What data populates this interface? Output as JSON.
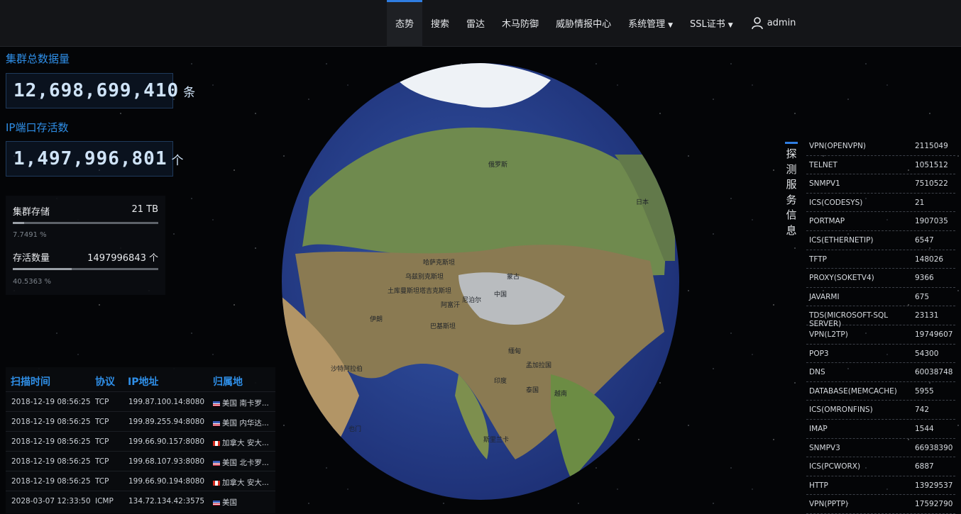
{
  "nav": {
    "items": [
      "态势",
      "搜索",
      "雷达",
      "木马防御",
      "威胁情报中心"
    ],
    "dropdowns": [
      "系统管理",
      "SSL证书"
    ],
    "user": "admin",
    "accent_color": "#2f7de1"
  },
  "stats": {
    "total_title": "集群总数据量",
    "total_value": "12,698,699,410",
    "total_unit": "条",
    "alive_title": "IP端口存活数",
    "alive_value": "1,497,996,801",
    "alive_unit": "个"
  },
  "storage": {
    "storage_label": "集群存储",
    "storage_value": "21 TB",
    "storage_pct": "7.7491 %",
    "storage_fraction": 0.077491,
    "alive_label": "存活数量",
    "alive_value": "1497996843 个",
    "alive_pct": "40.5363 %",
    "alive_fraction": 0.405363
  },
  "scan_table": {
    "headers": [
      "扫描时间",
      "协议",
      "IP地址",
      "归属地"
    ],
    "rows": [
      {
        "time": "2018-12-19 08:56:25",
        "proto": "TCP",
        "ip": "199.87.100.14:8080",
        "flag": "us",
        "loc": "美国 南卡罗..."
      },
      {
        "time": "2018-12-19 08:56:25",
        "proto": "TCP",
        "ip": "199.89.255.94:8080",
        "flag": "us",
        "loc": "美国 内华达..."
      },
      {
        "time": "2018-12-19 08:56:25",
        "proto": "TCP",
        "ip": "199.66.90.157:8080",
        "flag": "ca",
        "loc": "加拿大 安大..."
      },
      {
        "time": "2018-12-19 08:56:25",
        "proto": "TCP",
        "ip": "199.68.107.93:8080",
        "flag": "us",
        "loc": "美国 北卡罗..."
      },
      {
        "time": "2018-12-19 08:56:25",
        "proto": "TCP",
        "ip": "199.66.90.194:8080",
        "flag": "ca",
        "loc": "加拿大 安大..."
      },
      {
        "time": "2028-03-07 12:33:50",
        "proto": "ICMP",
        "ip": "134.72.134.42:3575",
        "flag": "us",
        "loc": "美国"
      }
    ]
  },
  "globe": {
    "labels": [
      "俄罗斯",
      "蒙古",
      "中国",
      "日本",
      "印度",
      "哈萨克斯坦",
      "乌兹别克斯坦",
      "土库曼斯坦",
      "阿富汗",
      "巴基斯坦",
      "伊朗",
      "沙特阿拉伯",
      "也门",
      "尼泊尔",
      "缅甸",
      "泰国",
      "越南",
      "斯里兰卡",
      "孟加拉国",
      "塔吉克斯坦"
    ]
  },
  "side_tab": {
    "chars": [
      "探",
      "测",
      "服",
      "务",
      "信",
      "息"
    ]
  },
  "services": [
    {
      "name": "VPN(OPENVPN)",
      "count": "2115049"
    },
    {
      "name": "TELNET",
      "count": "1051512"
    },
    {
      "name": "SNMPV1",
      "count": "7510522"
    },
    {
      "name": "ICS(CODESYS)",
      "count": "21"
    },
    {
      "name": "PORTMAP",
      "count": "1907035"
    },
    {
      "name": "ICS(ETHERNETIP)",
      "count": "6547"
    },
    {
      "name": "TFTP",
      "count": "148026"
    },
    {
      "name": "PROXY(SOKETV4)",
      "count": "9366"
    },
    {
      "name": "JAVARMI",
      "count": "675"
    },
    {
      "name": "TDS(MICROSOFT-SQL SERVER)",
      "count": "23131"
    },
    {
      "name": "VPN(L2TP)",
      "count": "19749607"
    },
    {
      "name": "POP3",
      "count": "54300"
    },
    {
      "name": "DNS",
      "count": "60038748"
    },
    {
      "name": "DATABASE(MEMCACHE)",
      "count": "5955"
    },
    {
      "name": "ICS(OMRONFINS)",
      "count": "742"
    },
    {
      "name": "IMAP",
      "count": "1544"
    },
    {
      "name": "SNMPV3",
      "count": "66938390"
    },
    {
      "name": "ICS(PCWORX)",
      "count": "6887"
    },
    {
      "name": "HTTP",
      "count": "13929537"
    },
    {
      "name": "VPN(PPTP)",
      "count": "17592790"
    }
  ]
}
